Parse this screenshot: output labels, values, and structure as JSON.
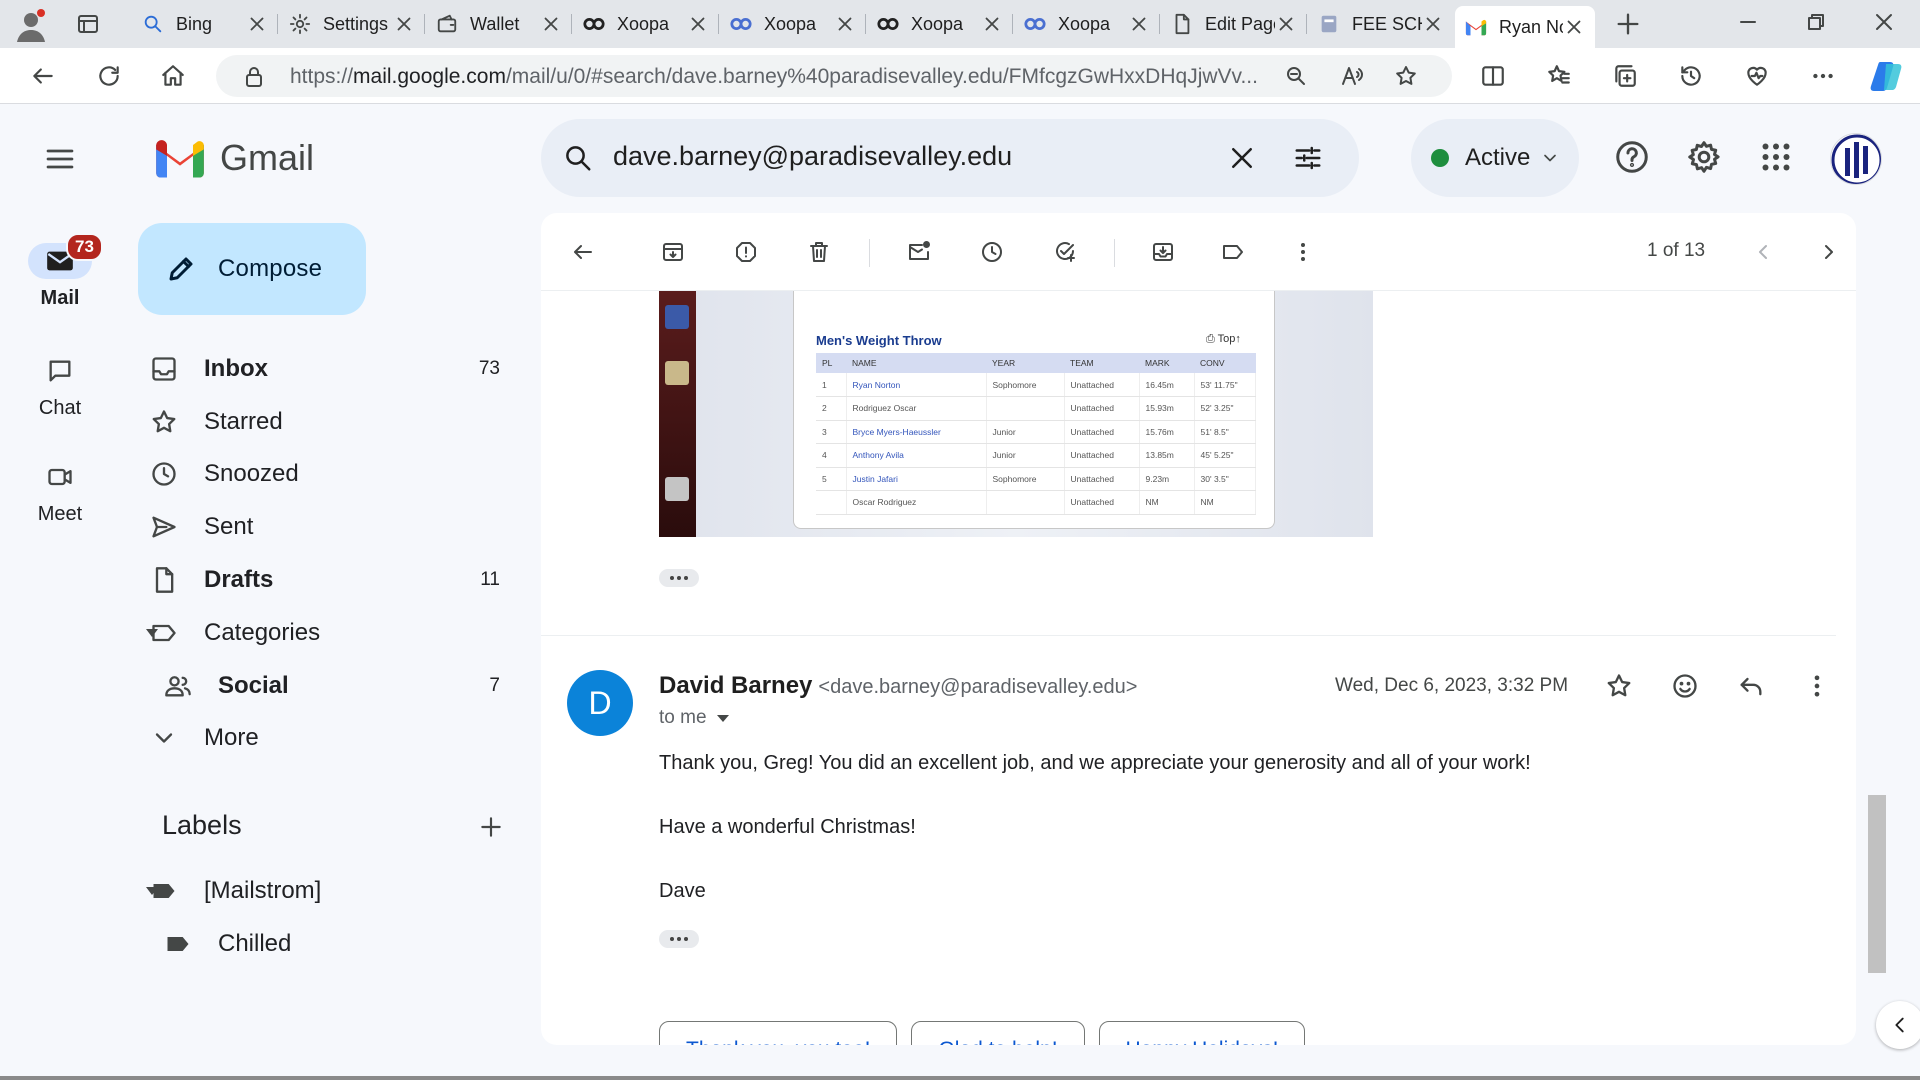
{
  "browser": {
    "tabs": [
      {
        "title": "Bing",
        "icon": "search-icon"
      },
      {
        "title": "Settings",
        "icon": "gear-icon"
      },
      {
        "title": "Wallet",
        "icon": "wallet-icon"
      },
      {
        "title": "Xoopa",
        "icon": "xoopa-icon"
      },
      {
        "title": "Xoopa",
        "icon": "xoopa-blue-icon"
      },
      {
        "title": "Xoopa",
        "icon": "xoopa-icon"
      },
      {
        "title": "Xoopa",
        "icon": "xoopa-blue-icon"
      },
      {
        "title": "Edit Page",
        "icon": "document-icon"
      },
      {
        "title": "FEE SCHEDULE",
        "icon": "site-logo-icon"
      },
      {
        "title": "Ryan Norton",
        "icon": "gmail-icon",
        "active": true
      }
    ],
    "url_prefix": "https://",
    "url_host": "mail.google.com",
    "url_path": "/mail/u/0/#search/dave.barney%40paradisevalley.edu/FMfcgzGwHxxDHqJjwVv..."
  },
  "gmail": {
    "app_name": "Gmail",
    "search_query": "dave.barney@paradisevalley.edu",
    "status_label": "Active",
    "colors": {
      "accent": "#0b57d0",
      "compose_bg": "#c2e7ff",
      "badge": "#b3261e",
      "status_green": "#1e8e3e",
      "avatar": "#0b83d9"
    }
  },
  "rail": {
    "mail_label": "Mail",
    "mail_badge": "73",
    "chat_label": "Chat",
    "meet_label": "Meet"
  },
  "sidebar": {
    "compose_label": "Compose",
    "items": [
      {
        "label": "Inbox",
        "count": "73",
        "icon": "inbox-icon",
        "bold": true
      },
      {
        "label": "Starred",
        "count": "",
        "icon": "star-icon"
      },
      {
        "label": "Snoozed",
        "count": "",
        "icon": "clock-icon"
      },
      {
        "label": "Sent",
        "count": "",
        "icon": "send-icon"
      },
      {
        "label": "Drafts",
        "count": "11",
        "icon": "draft-icon",
        "bold": true
      },
      {
        "label": "Categories",
        "count": "",
        "icon": "label-outline-icon"
      },
      {
        "label": "Social",
        "count": "7",
        "icon": "people-icon",
        "bold": true
      },
      {
        "label": "More",
        "count": "",
        "icon": "chevron-down-icon"
      }
    ],
    "labels_title": "Labels",
    "labels": [
      {
        "label": "[Mailstrom]"
      },
      {
        "label": "Chilled"
      }
    ]
  },
  "toolbar": {
    "pager": "1 of 13"
  },
  "embed": {
    "title": "Men's Weight Throw",
    "top_link": "Top",
    "columns": [
      "PL",
      "NAME",
      "YEAR",
      "TEAM",
      "MARK",
      "CONV"
    ],
    "rows": [
      [
        "1",
        "Ryan Norton",
        "Sophomore",
        "Unattached",
        "16.45m",
        "53' 11.75\""
      ],
      [
        "2",
        "Rodriguez Oscar",
        "",
        "Unattached",
        "15.93m",
        "52' 3.25\""
      ],
      [
        "3",
        "Bryce Myers-Haeussler",
        "Junior",
        "Unattached",
        "15.76m",
        "51' 8.5\""
      ],
      [
        "4",
        "Anthony Avila",
        "Junior",
        "Unattached",
        "13.85m",
        "45' 5.25\""
      ],
      [
        "5",
        "Justin Jafari",
        "Sophomore",
        "Unattached",
        "9.23m",
        "30' 3.5\""
      ],
      [
        "",
        "Oscar Rodriguez",
        "",
        "Unattached",
        "NM",
        "NM"
      ]
    ]
  },
  "message": {
    "avatar_letter": "D",
    "sender_name": "David Barney",
    "sender_email": "<dave.barney@paradisevalley.edu>",
    "to": "to me",
    "date": "Wed, Dec 6, 2023, 3:32 PM",
    "body": [
      "Thank you, Greg!  You did an excellent job, and we appreciate your generosity and all of your work!",
      "Have a wonderful Christmas!",
      "Dave"
    ],
    "smart_replies": [
      "Thank you, you too!",
      "Glad to help!",
      "Happy Holidays!"
    ]
  }
}
